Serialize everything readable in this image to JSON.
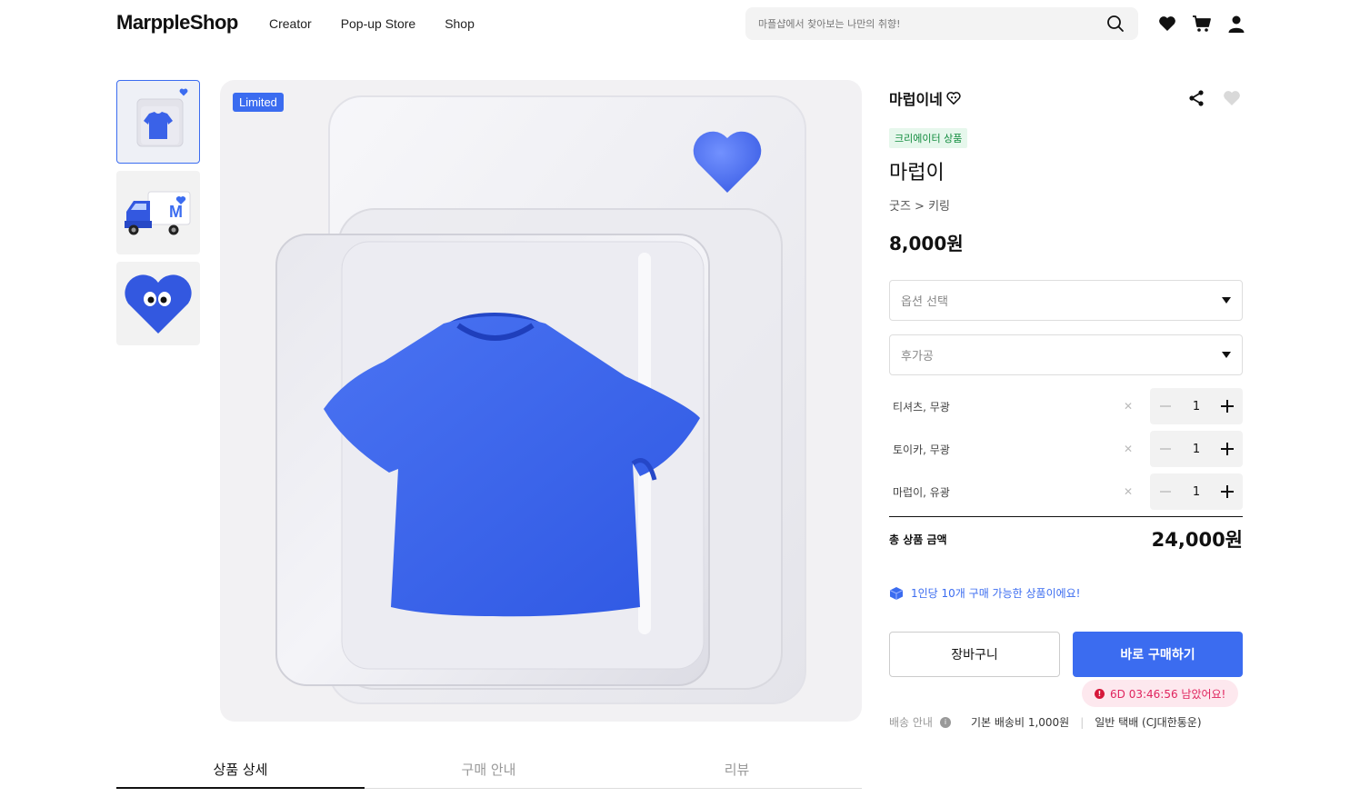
{
  "header": {
    "logo": "MarppleShop",
    "nav": [
      "Creator",
      "Pop-up Store",
      "Shop"
    ],
    "search_placeholder": "마플샵에서 찾아보는 나만의 취향!"
  },
  "product_media": {
    "limited_label": "Limited",
    "thumbnails": [
      "t-shirt-toy",
      "truck-toy",
      "heart-character"
    ]
  },
  "product": {
    "creator": "마럽이네",
    "badge": "크리에이터 상품",
    "title": "마럽이",
    "category": "굿즈 > 키링",
    "price": "8,000원",
    "option_select_placeholder": "옵션 선택",
    "post_process_placeholder": "후가공",
    "selected_options": [
      {
        "name": "티셔츠, 무광",
        "qty": "1"
      },
      {
        "name": "토이카, 무광",
        "qty": "1"
      },
      {
        "name": "마럽이, 유광",
        "qty": "1"
      }
    ],
    "total_label": "총 상품 금액",
    "total_value": "24,000원",
    "purchase_limit_note": "1인당 10개 구매 가능한 상품이에요!",
    "cart_button": "장바구니",
    "buy_button": "바로 구매하기",
    "timer_text": "6D 03:46:56 남았어요!",
    "shipping_label": "배송 안내",
    "shipping_fee": "기본 배송비 1,000원",
    "shipping_method": "일반 택배 (CJ대한통운)"
  },
  "tabs": [
    "상품 상세",
    "구매 안내",
    "리뷰"
  ],
  "colors": {
    "accent": "#3b6cf0",
    "badge_bg": "#e6f7ec",
    "badge_text": "#128c3e",
    "timer_bg": "#fde8ee",
    "timer_text": "#e0245e"
  }
}
